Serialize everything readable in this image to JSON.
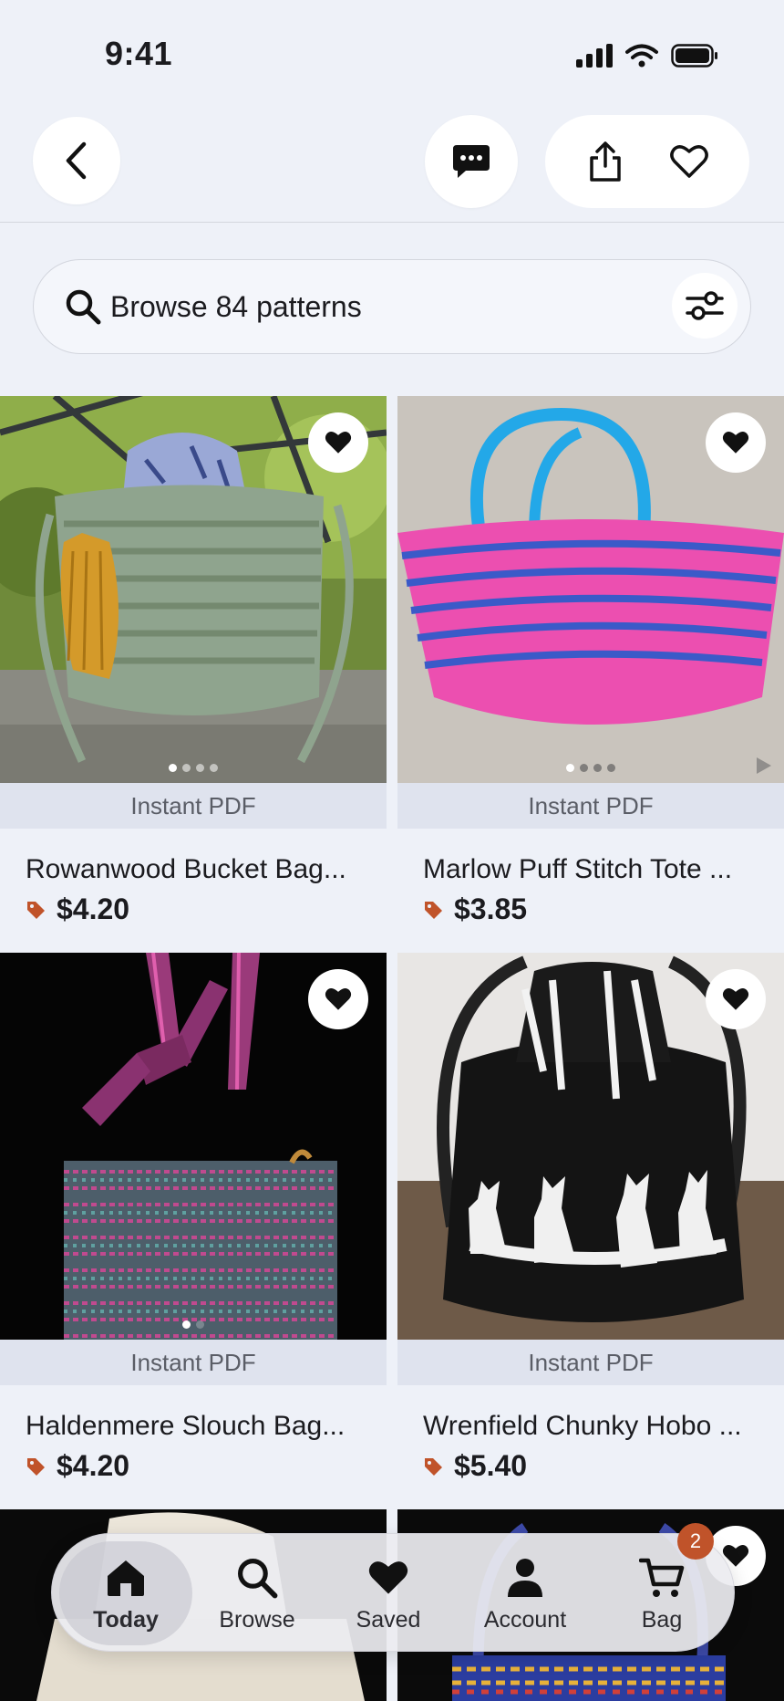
{
  "status_bar": {
    "time": "9:41"
  },
  "search": {
    "text": "Browse 84 patterns"
  },
  "badge_label": "Instant PDF",
  "products": [
    {
      "title": "Rowanwood Bucket Bag...",
      "price": "$4.20"
    },
    {
      "title": "Marlow Puff Stitch Tote ...",
      "price": "$3.85"
    },
    {
      "title": "Haldenmere Slouch Bag...",
      "price": "$4.20"
    },
    {
      "title": "Wrenfield Chunky Hobo ...",
      "price": "$5.40"
    }
  ],
  "tabs": [
    {
      "label": "Today",
      "active": true
    },
    {
      "label": "Browse",
      "active": false
    },
    {
      "label": "Saved",
      "active": false
    },
    {
      "label": "Account",
      "active": false
    },
    {
      "label": "Bag",
      "active": false
    }
  ],
  "bag_count": "2",
  "colors": {
    "accent": "#c0532a",
    "background": "#eef1f8"
  }
}
